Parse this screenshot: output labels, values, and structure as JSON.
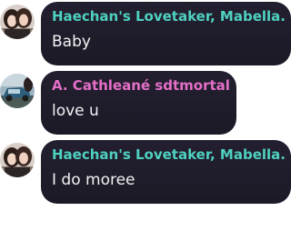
{
  "messages": [
    {
      "author": "Haechan's Lovetaker, Mabella.",
      "author_color": "#4fd1c0",
      "text": "Baby",
      "avatar_icon": "two-people-photo-icon"
    },
    {
      "author": "A. Cathleané sdtmortal",
      "author_color": "#e36fc7",
      "text": "love u",
      "avatar_icon": "car-photo-icon"
    },
    {
      "author": "Haechan's Lovetaker, Mabella.",
      "author_color": "#4fd1c0",
      "text": "I do moree",
      "avatar_icon": "two-people-photo-icon"
    }
  ],
  "colors": {
    "bubble": "#1f1c2a",
    "message_text": "#f2f2f4",
    "background": "#ffffff"
  }
}
